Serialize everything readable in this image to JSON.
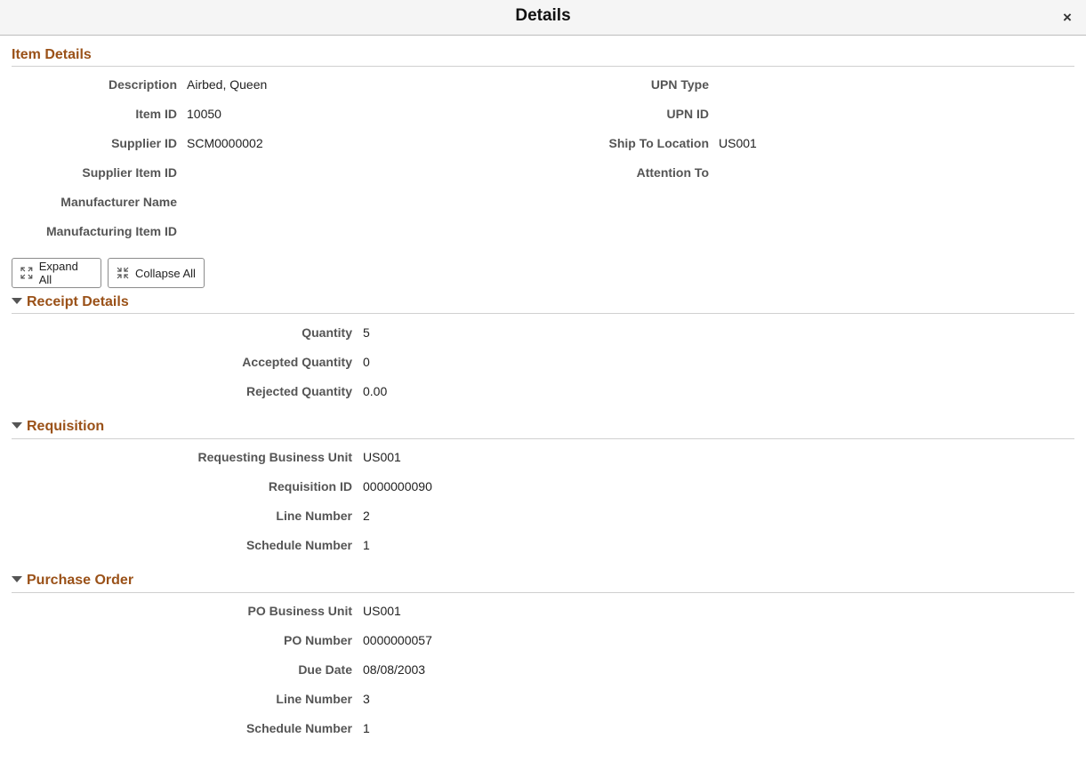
{
  "header": {
    "title": "Details",
    "close_label": "×"
  },
  "item_details": {
    "title": "Item Details",
    "left": [
      {
        "label": "Description",
        "value": "Airbed, Queen"
      },
      {
        "label": "Item ID",
        "value": "10050"
      },
      {
        "label": "Supplier ID",
        "value": "SCM0000002"
      },
      {
        "label": "Supplier Item ID",
        "value": ""
      },
      {
        "label": "Manufacturer Name",
        "value": ""
      },
      {
        "label": "Manufacturing Item ID",
        "value": ""
      }
    ],
    "right": [
      {
        "label": "UPN Type",
        "value": ""
      },
      {
        "label": "UPN ID",
        "value": ""
      },
      {
        "label": "Ship To Location",
        "value": "US001"
      },
      {
        "label": "Attention To",
        "value": ""
      }
    ]
  },
  "toolbar": {
    "expand_all": "Expand All",
    "collapse_all": "Collapse All"
  },
  "receipt_details": {
    "title": "Receipt Details",
    "fields": [
      {
        "label": "Quantity",
        "value": "5"
      },
      {
        "label": "Accepted Quantity",
        "value": "0"
      },
      {
        "label": "Rejected Quantity",
        "value": "0.00"
      }
    ]
  },
  "requisition": {
    "title": "Requisition",
    "fields": [
      {
        "label": "Requesting Business Unit",
        "value": "US001"
      },
      {
        "label": "Requisition ID",
        "value": "0000000090"
      },
      {
        "label": "Line Number",
        "value": "2"
      },
      {
        "label": "Schedule Number",
        "value": "1"
      }
    ]
  },
  "purchase_order": {
    "title": "Purchase Order",
    "fields": [
      {
        "label": "PO Business Unit",
        "value": "US001"
      },
      {
        "label": "PO Number",
        "value": "0000000057"
      },
      {
        "label": "Due Date",
        "value": "08/08/2003"
      },
      {
        "label": "Line Number",
        "value": "3"
      },
      {
        "label": "Schedule Number",
        "value": "1"
      }
    ]
  }
}
